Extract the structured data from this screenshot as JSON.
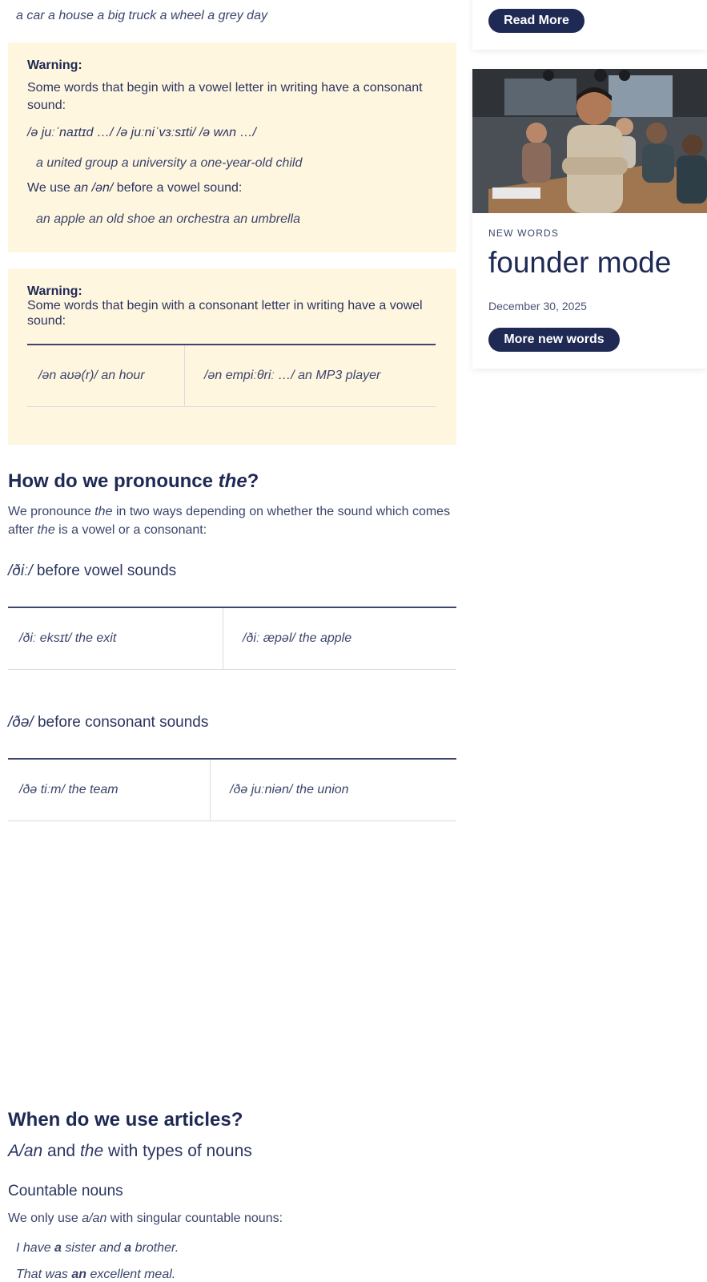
{
  "top_examples": "a car a house a big truck a wheel a grey day",
  "warning1": {
    "title": "Warning:",
    "text": "Some words that begin with a vowel letter in writing have a consonant sound:",
    "phonetic": "/ə juːˈnaɪtɪd …/ /ə juːniˈvɜːsɪti/ /ə wʌn …/",
    "examples": "a united group a university a one-year-old child",
    "use_prefix": "We use",
    "use_an": "an /ən/",
    "use_suffix": "before a vowel sound:",
    "examples2": "an apple an old shoe an orchestra an umbrella"
  },
  "warning2": {
    "title": "Warning:",
    "text": "Some words that begin with a consonant letter in writing have a vowel sound:",
    "cells": [
      "/ən aʊə(r)/ an hour",
      "/ən empiːθriː …/ an MP3 player"
    ]
  },
  "pronounce": {
    "heading_prefix": "How do we pronounce",
    "heading_the": "the",
    "heading_suffix": "?",
    "para_1": "We pronounce",
    "para_the1": "the",
    "para_2": "in two ways depending on whether the sound which comes after",
    "para_the2": "the",
    "para_3": "is a vowel or a consonant:",
    "vowel_phon": "/ðiː/",
    "vowel_label": "before vowel sounds",
    "vowel_cells": [
      "/ðiː eksɪt/ the exit",
      "/ðiː æpəl/ the apple"
    ],
    "cons_phon": "/ðə/",
    "cons_label": "before consonant sounds",
    "cons_cells": [
      "/ðə tiːm/ the team",
      "/ðə juːniən/ the union"
    ]
  },
  "articles": {
    "heading": "When do we use articles?",
    "sub_aan": "A/an",
    "sub_and": "and",
    "sub_the": "the",
    "sub_rest": "with types of nouns",
    "countable": "Countable nouns",
    "only_prefix": "We only use",
    "only_aan": "a/an",
    "only_suffix": "with singular countable nouns:",
    "ex1_a": "I have",
    "ex1_b": "a",
    "ex1_c": "sister and",
    "ex1_d": "a",
    "ex1_e": "brother.",
    "ex2_a": "That was",
    "ex2_b": "an",
    "ex2_c": "excellent meal."
  },
  "sidebar": {
    "read_more": "Read More",
    "category": "NEW WORDS",
    "title": "founder mode",
    "date": "December 30, 2025",
    "more_button": "More new words"
  },
  "colors": {
    "navy": "#1e2954",
    "warning_bg": "#fff6e0"
  }
}
